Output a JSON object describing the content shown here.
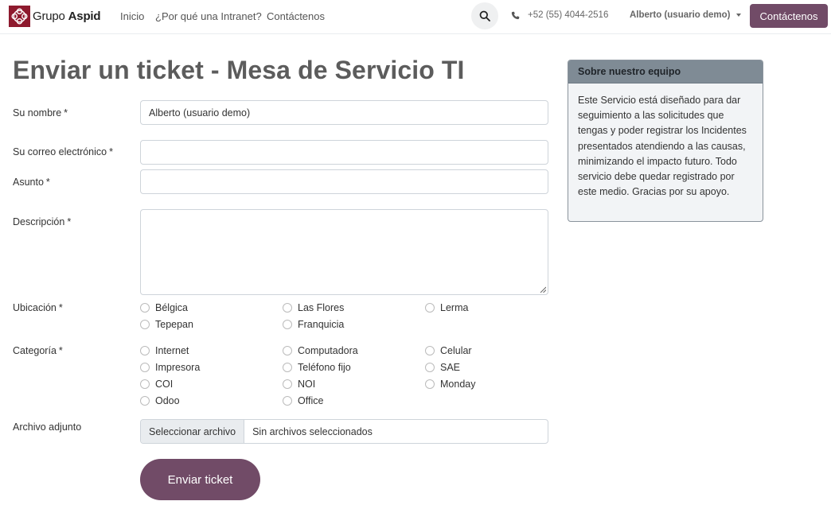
{
  "colors": {
    "brand": "#714b67",
    "card_header": "#7f8b95"
  },
  "navbar": {
    "brand_name": "Grupo",
    "brand_name_bold": "Aspid",
    "links": [
      "Inicio",
      "¿Por qué una Intranet?",
      "Contáctenos"
    ],
    "phone": "+52 (55) 4044-2516",
    "user": "Alberto (usuario demo)",
    "cta": "Contáctenos"
  },
  "form": {
    "title": "Enviar un ticket - Mesa de Servicio TI",
    "required_mark": "*",
    "name_label": "Su nombre",
    "name_value": "Alberto (usuario demo)",
    "email_label": "Su correo electrónico",
    "email_value": "",
    "subject_label": "Asunto",
    "subject_value": "",
    "description_label": "Descripción",
    "location_label": "Ubicación",
    "locations": [
      "Bélgica",
      "Las Flores",
      "Lerma",
      "Tepepan",
      "Franquicia"
    ],
    "category_label": "Categoría",
    "categories": [
      "Internet",
      "Computadora",
      "Celular",
      "Impresora",
      "Teléfono fijo",
      "SAE",
      "COI",
      "NOI",
      "Monday",
      "Odoo",
      "Office"
    ],
    "attachment_label": "Archivo adjunto",
    "file_button": "Seleccionar archivo",
    "file_status": "Sin archivos seleccionados",
    "submit": "Enviar ticket"
  },
  "side_card": {
    "title": "Sobre nuestro equipo",
    "body": "Este Servicio está diseñado para dar seguimiento a las solicitudes que tengas y poder registrar los Incidentes presentados atendiendo a las causas, minimizando el impacto futuro. Todo servicio debe quedar registrado por este medio. Gracias por su apoyo."
  }
}
